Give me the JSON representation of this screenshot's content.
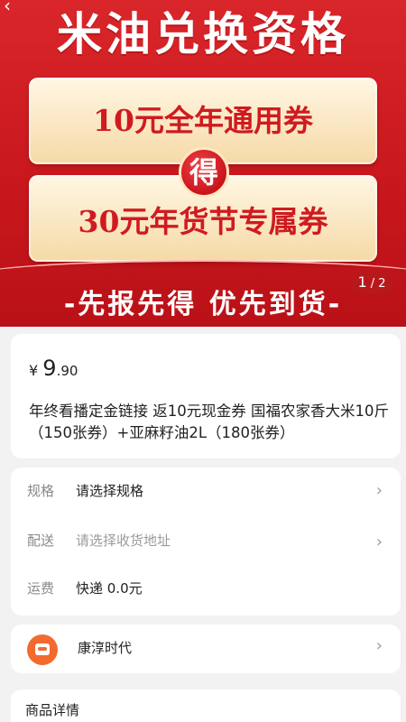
{
  "banner": {
    "title": "米油兑换资格",
    "coupon_top": "10元全年通用券",
    "connector": "得",
    "coupon_bottom": "30元年货节专属券",
    "subtitle": "-先报先得 优先到货-",
    "indicator": {
      "current": "1",
      "total": "/ 2"
    }
  },
  "price": {
    "symbol": "¥",
    "integer": "9",
    "decimal": ".90"
  },
  "product_title": "年终看播定金链接 返10元现金券 国福农家香大米10斤（150张券）+亚麻籽油2L（180张券）",
  "spec": {
    "rows": [
      {
        "label": "规格",
        "value": "请选择规格"
      },
      {
        "label": "配送",
        "value": "请选择收货地址"
      },
      {
        "label": "运费",
        "value": "快递 0.0元"
      }
    ]
  },
  "shop": {
    "name": "康淳时代"
  },
  "details": {
    "title": "商品详情"
  },
  "icons": {
    "chevron": "chevron-right-icon",
    "shop_logo": "shop-logo-icon"
  },
  "colors": {
    "banner_red": "#d9262b",
    "coupon_text": "#cf1b20",
    "shop_logo": "#f26a2e"
  }
}
